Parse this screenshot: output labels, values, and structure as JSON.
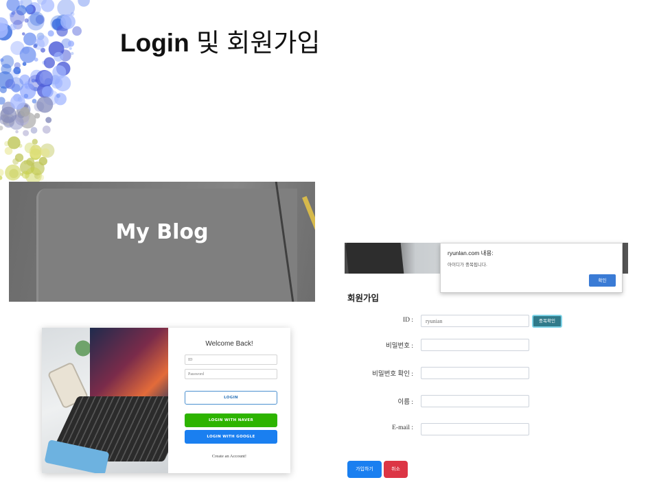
{
  "slide": {
    "title_en": "Login",
    "title_kr": "및 회원가입"
  },
  "blog": {
    "title": "My Blog"
  },
  "login": {
    "welcome": "Welcome Back!",
    "id_placeholder": "ID",
    "password_placeholder": "Password",
    "login_button": "LOGIN",
    "naver_button": "LOGIN WITH NAVER",
    "google_button": "LOGIN WITH GOOGLE",
    "create_account": "Create an Account!"
  },
  "dialog": {
    "title": "ryunlan.com 내용:",
    "message": "아이디가 중복됩니다.",
    "ok_button": "확인"
  },
  "signup": {
    "title": "회원가입",
    "id_label": "ID :",
    "id_value": "ryunian",
    "check_button": "중복확인",
    "password_label": "비밀번호 :",
    "password_confirm_label": "비밀번호 확인 :",
    "name_label": "이름 :",
    "email_label": "E-mail :",
    "join_button": "가입하기",
    "cancel_button": "취소"
  },
  "colors": {
    "naver_green": "#2db400",
    "google_blue": "#1a7ff0",
    "cancel_red": "#dc3545",
    "check_teal": "#2f7a8a",
    "dialog_blue": "#3a7bd5"
  }
}
